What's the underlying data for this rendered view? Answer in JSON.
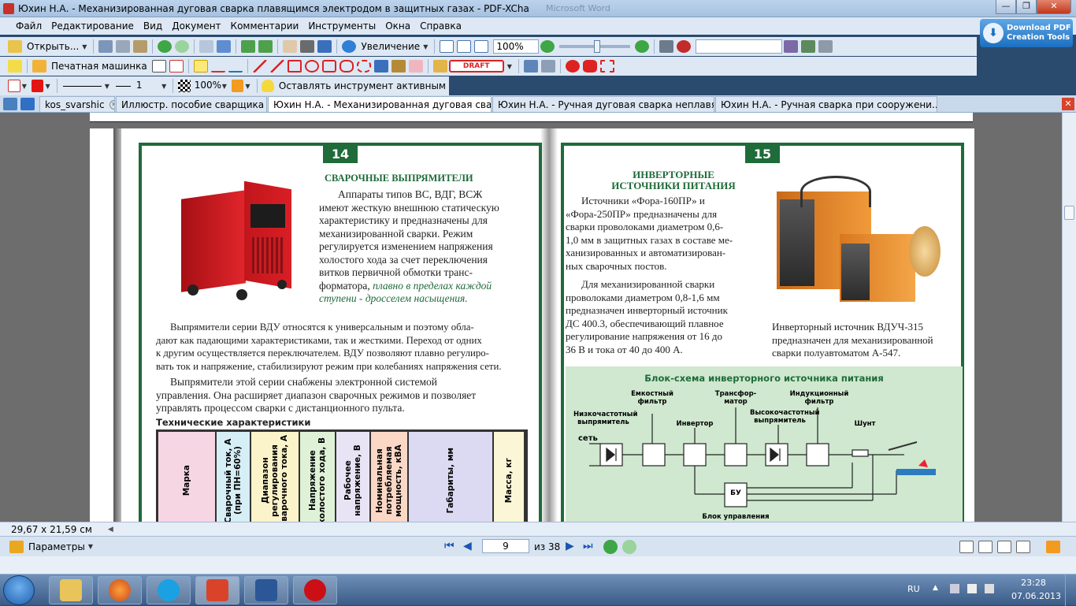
{
  "window": {
    "title": "Юхин Н.А. - Механизированная дуговая сварка плавящимся электродом в защитных газах - PDF-XChange Viewer",
    "ghost_title": "Microsoft Word",
    "min": "—",
    "max": "❐",
    "close": "✕"
  },
  "menu": [
    "Файл",
    "Редактирование",
    "Вид",
    "Документ",
    "Комментарии",
    "Инструменты",
    "Окна",
    "Справка"
  ],
  "promo": {
    "line1": "Download PDF",
    "line2": "Creation Tools"
  },
  "toolbar1": {
    "open_label": "Открыть...",
    "zoom_label": "Увеличение",
    "zoom_value": "100%"
  },
  "toolbar2": {
    "typewriter_label": "Печатная машинка",
    "stamp_label": "DRAFT"
  },
  "toolbar3": {
    "opacity": "100%",
    "line_width": "1",
    "keep_tool": "Оставлять инструмент активным"
  },
  "tabs": [
    {
      "label": "kos_svarshic",
      "active": false
    },
    {
      "label": "Иллюстр. пособие сварщика",
      "active": false
    },
    {
      "label": "Юхин Н.А. - Механизированная дуговая сва...",
      "active": true
    },
    {
      "label": "Юхин Н.А. - Ручная дуговая сварка неплавя...",
      "active": false
    },
    {
      "label": "Юхин Н.А. - Ручная сварка при сооружени...",
      "active": false
    }
  ],
  "document": {
    "left": {
      "page_num": "14",
      "heading": "СВАРОЧНЫЕ ВЫПРЯМИТЕЛИ",
      "para1_lines": [
        "Аппараты типов ВС, ВДГ, ВСЖ",
        "имеют жесткую внешнюю статическую",
        "характеристику и предназначены для",
        "механизированной сварки. Режим",
        "регулируется изменением напряжения",
        "холостого хода за счет переключения",
        "витков первичной обмотки транс-",
        "форматора,"
      ],
      "para1_italic1": "плавно в пределах каждой",
      "para1_italic2": "ступени - дросселем насыщения.",
      "para2_lines": [
        "Выпрямители серии ВДУ относятся к универсальным и поэтому обла-",
        "дают как падающими характеристиками, так и жесткими. Переход от одних",
        "к другим осуществляется переключателем. ВДУ позволяют плавно регулиро-",
        "вать ток и напряжение, стабилизируют режим при колебаниях напряжения сети."
      ],
      "para3_lines": [
        "Выпрямители этой серии снабжены электронной системой",
        "управления. Она расширяет диапазон сварочных режимов и позволяет",
        "управлять процессом сварки с дистанционного пульта."
      ],
      "table_title": "Технические характеристики",
      "table_headers": [
        "Марка",
        "Сварочный ток, А (при ПН=60%)",
        "Диапазон регулирования сварочного тока, А",
        "Напряжение холостого хода, В",
        "Рабочее напряжение, В",
        "Номинальная потребляемая мощность, кВА",
        "Габариты, мм",
        "Масса, кг"
      ],
      "table_colors": [
        "#f7d6e4",
        "#d6eef6",
        "#fbf3c9",
        "#dff2d8",
        "#e9e4f5",
        "#fbd7c6",
        "#dcdaf3",
        "#fbf6d6"
      ]
    },
    "right": {
      "page_num": "15",
      "heading_l1": "ИНВЕРТОРНЫЕ",
      "heading_l2": "ИСТОЧНИКИ ПИТАНИЯ",
      "para1_lines": [
        "Источники «Фора-160ПР» и",
        "«Фора-250ПР» предназначены для",
        "сварки проволоками диаметром 0,6-",
        "1,0 мм в защитных газах в составе ме-",
        "ханизированных и автоматизирован-",
        "ных сварочных постов."
      ],
      "para2_lines": [
        "Для механизированной сварки",
        "проволоками диаметром 0,8-1,6 мм",
        "предназначен инверторный источник",
        "ДС 400.3, обеспечивающий плавное",
        "регулирование напряжения от 16 до",
        "36 В и тока от 40 до 400 А."
      ],
      "caption_lines": [
        "Инверторный источник ВДУЧ-315",
        "предназначен для механизированной",
        "сварки полуавтоматом А-547."
      ],
      "diagram_title": "Блок-схема инверторного источника питания",
      "labels": {
        "net": "сеть",
        "lf_rect": "Низкочастотный выпрямитель",
        "cap_filter": "Емкостный фильтр",
        "inverter": "Инвертор",
        "transformer": "Трансфор- матор",
        "hf_rect": "Высокочастотный выпрямитель",
        "ind_filter": "Индукционный фильтр",
        "shunt": "Шунт",
        "bu": "БУ",
        "ctrl": "Блок управления"
      }
    }
  },
  "status": {
    "page_size": "29,67 x 21,59 см"
  },
  "nav": {
    "params_label": "Параметры",
    "page": "9",
    "of_pages": "из 38"
  },
  "taskbar": {
    "lang": "RU",
    "time": "23:28",
    "date": "07.06.2013"
  }
}
